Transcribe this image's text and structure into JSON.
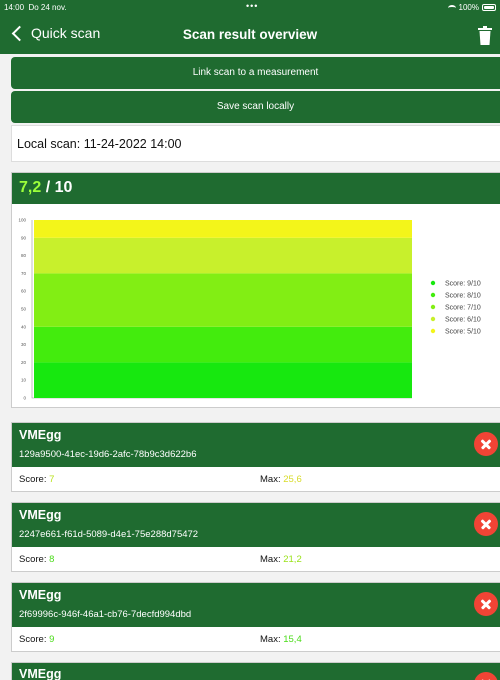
{
  "status": {
    "time": "14:00",
    "date": "Do 24 nov.",
    "dots": "•••",
    "battery": "100%",
    "battery_level": 1.0
  },
  "nav": {
    "back_label": "Quick scan",
    "title": "Scan result overview"
  },
  "actions": {
    "link_label": "Link scan to a measurement",
    "save_label": "Save scan locally"
  },
  "local_scan": "Local scan: 11-24-2022 14:00",
  "score": {
    "value": "7,2",
    "separator": " / ",
    "total": "10"
  },
  "chart_data": {
    "type": "bar",
    "yticks": [
      "0",
      "10",
      "20",
      "30",
      "40",
      "50",
      "60",
      "70",
      "80",
      "90",
      "100"
    ],
    "ylim": [
      0,
      100
    ],
    "bands": [
      {
        "name": "Score: 9/10",
        "from": 0,
        "to": 20,
        "color": "#17e80f"
      },
      {
        "name": "Score: 8/10",
        "from": 20,
        "to": 40,
        "color": "#43ec0d"
      },
      {
        "name": "Score: 7/10",
        "from": 40,
        "to": 70,
        "color": "#82ee14"
      },
      {
        "name": "Score: 6/10",
        "from": 70,
        "to": 90,
        "color": "#c8f02c"
      },
      {
        "name": "Score: 5/10",
        "from": 90,
        "to": 100,
        "color": "#f3f51a"
      }
    ],
    "legend_position": "right",
    "grid": false
  },
  "items": [
    {
      "name": "VMEgg",
      "id": "129a9500-41ec-19d6-2afc-78b9c3d622b6",
      "score_label": "Score:",
      "score": "7",
      "max_label": "Max:",
      "max": "25,6"
    },
    {
      "name": "VMEgg",
      "id": "2247e661-f61d-5089-d4e1-75e288d75472",
      "score_label": "Score:",
      "score": "8",
      "max_label": "Max:",
      "max": "21,2"
    },
    {
      "name": "VMEgg",
      "id": "2f69996c-946f-46a1-cb76-7decfd994dbd",
      "score_label": "Score:",
      "score": "9",
      "max_label": "Max:",
      "max": "15,4"
    },
    {
      "name": "VMEgg"
    }
  ],
  "colors": {
    "brand": "#1f6b30",
    "delete": "#f14435",
    "score_highlight": "#9cff3a"
  }
}
